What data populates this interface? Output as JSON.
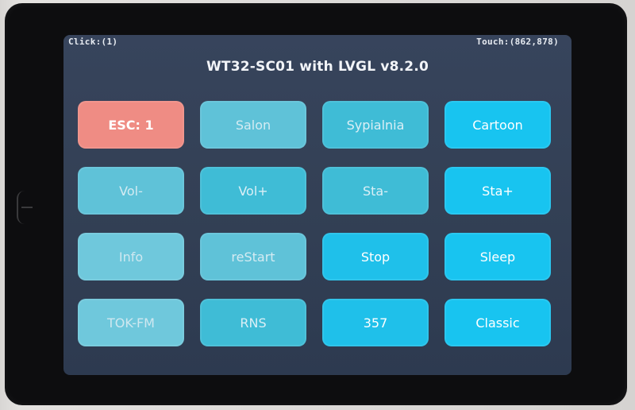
{
  "status": {
    "click": "Click:(1)",
    "touch": "Touch:(862,878)"
  },
  "title": "WT32-SC01 with LVGL v8.2.0",
  "buttons": [
    {
      "label": "ESC: 1"
    },
    {
      "label": "Salon"
    },
    {
      "label": "Sypialnia"
    },
    {
      "label": "Cartoon"
    },
    {
      "label": "Vol-"
    },
    {
      "label": "Vol+"
    },
    {
      "label": "Sta-"
    },
    {
      "label": "Sta+"
    },
    {
      "label": "Info"
    },
    {
      "label": "reStart"
    },
    {
      "label": "Stop"
    },
    {
      "label": "Sleep"
    },
    {
      "label": "TOK-FM"
    },
    {
      "label": "RNS"
    },
    {
      "label": "357"
    },
    {
      "label": "Classic"
    }
  ],
  "colors": {
    "button_accent": "#1fc0ea",
    "button_active": "#ef8c84",
    "screen_bg": "#334055"
  }
}
